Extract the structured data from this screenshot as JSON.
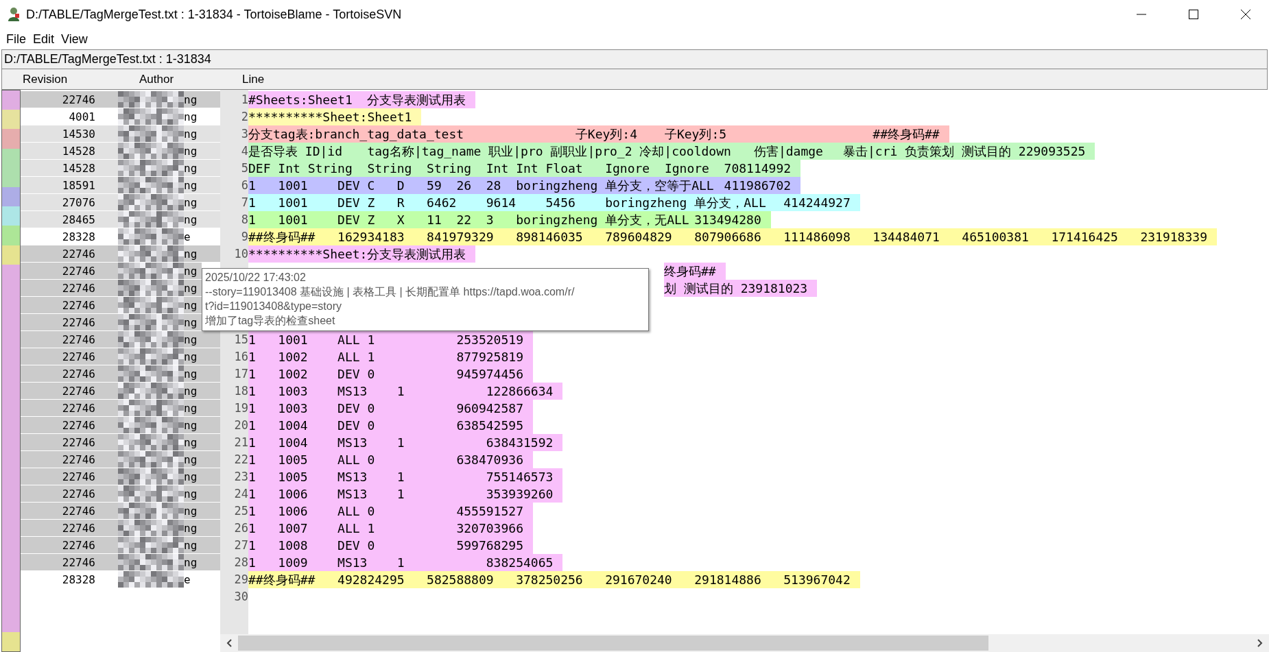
{
  "window": {
    "title": "D:/TABLE/TagMergeTest.txt : 1-31834 - TortoiseBlame - TortoiseSVN"
  },
  "menu": [
    {
      "label": "File"
    },
    {
      "label": "Edit"
    },
    {
      "label": "View"
    }
  ],
  "path_bar": "D:/TABLE/TagMergeTest.txt : 1-31834",
  "columns": [
    {
      "label": "Revision"
    },
    {
      "label": "Author"
    },
    {
      "label": "Line"
    }
  ],
  "lines": [
    {
      "number": "1",
      "revision": "22746",
      "author": "ng",
      "kind": "dark",
      "color": "#f9c0fb",
      "text": "#Sheets:Sheet1\t分支导表测试用表"
    },
    {
      "number": "2",
      "revision": "4001",
      "author": "ng",
      "kind": "none",
      "color": "#fffbb0",
      "text": "**********Sheet:Sheet1"
    },
    {
      "number": "3",
      "revision": "14530",
      "author": "ng",
      "kind": "light",
      "color": "#ffc0c0",
      "text": "分支tag表:branch_tag_data_test\t\t\t\t子Key列:4\t子Key列:5\t\t\t\t\t##终身码##"
    },
    {
      "number": "4",
      "revision": "14528",
      "author": "ng",
      "kind": "light",
      "color": "#c0f8c0",
      "text": "是否导表 ID|id\ttag名称|tag_name 职业|pro 副职业|pro_2 冷却|cooldown\t伤害|damge\t暴击|cri 负责策划 测试目的 229093525"
    },
    {
      "number": "5",
      "revision": "14528",
      "author": "ng",
      "kind": "light",
      "color": "#c0f8c0",
      "text": "DEF\tInt\tString\tString\tString\tInt\tInt\tFloat\tIgnore\tIgnore\t708114992"
    },
    {
      "number": "6",
      "revision": "18591",
      "author": "ng",
      "kind": "light",
      "color": "#c0c0ff",
      "text": "1\t1001\tDEV\tC\tD\t59\t26\t28\tboringzheng\t单分支，空等于ALL\t411986702"
    },
    {
      "number": "7",
      "revision": "27076",
      "author": "ng",
      "kind": "light",
      "color": "#c0ffff",
      "text": "1\t1001\tDEV\tZ\tR\t6462\t9614\t5456\tboringzheng 单分支，ALL\t414244927"
    },
    {
      "number": "8",
      "revision": "28465",
      "author": "ng",
      "kind": "light",
      "color": "#c0ffa8",
      "text": "1\t1001\tDEV\tZ\tX\t11\t22\t3\tboringzheng\t单分支，无ALL\t313494280"
    },
    {
      "number": "9",
      "revision": "28328",
      "author": "e",
      "kind": "none",
      "color": "#fffca0",
      "text": "##终身码##\t162934183\t841979329\t898146035\t789604829\t807906686\t111486098\t134484071\t465100381\t171416425\t231918339"
    },
    {
      "number": "10",
      "revision": "22746",
      "author": "ng",
      "kind": "dark",
      "color": "#f9c0fb",
      "text": "**********Sheet:分支导表测试用表"
    },
    {
      "revision": "22746",
      "author": "ng",
      "kind": "dark",
      "color": "#f9c0fb",
      "covered": true,
      "text": "终身码##"
    },
    {
      "revision": "22746",
      "author": "ng",
      "kind": "dark",
      "color": "#f9c0fb",
      "covered": true,
      "text": "划 测试目的 239181023"
    },
    {
      "revision": "22746",
      "author": "ng",
      "kind": "dark",
      "covered": true
    },
    {
      "revision": "22746",
      "author": "ng",
      "kind": "dark",
      "covered": true
    },
    {
      "number": "15",
      "revision": "22746",
      "author": "ng",
      "kind": "dark",
      "color": "#f9c0fb",
      "text": "1\t1001\tALL\t1\t\t\t253520519"
    },
    {
      "number": "16",
      "revision": "22746",
      "author": "ng",
      "kind": "dark",
      "color": "#f9c0fb",
      "text": "1\t1002\tALL\t1\t\t\t877925819"
    },
    {
      "number": "17",
      "revision": "22746",
      "author": "ng",
      "kind": "dark",
      "color": "#f9c0fb",
      "text": "1\t1002\tDEV\t0\t\t\t945974456"
    },
    {
      "number": "18",
      "revision": "22746",
      "author": "ng",
      "kind": "dark",
      "color": "#f9c0fb",
      "text": "1\t1003\tMS13\t1\t\t\t122866634"
    },
    {
      "number": "19",
      "revision": "22746",
      "author": "ng",
      "kind": "dark",
      "color": "#f9c0fb",
      "text": "1\t1003\tDEV\t0\t\t\t960942587"
    },
    {
      "number": "20",
      "revision": "22746",
      "author": "ng",
      "kind": "dark",
      "color": "#f9c0fb",
      "text": "1\t1004\tDEV\t0\t\t\t638542595"
    },
    {
      "number": "21",
      "revision": "22746",
      "author": "ng",
      "kind": "dark",
      "color": "#f9c0fb",
      "text": "1\t1004\tMS13\t1\t\t\t638431592"
    },
    {
      "number": "22",
      "revision": "22746",
      "author": "ng",
      "kind": "dark",
      "color": "#f9c0fb",
      "text": "1\t1005\tALL\t0\t\t\t638470936"
    },
    {
      "number": "23",
      "revision": "22746",
      "author": "ng",
      "kind": "dark",
      "color": "#f9c0fb",
      "text": "1\t1005\tMS13\t1\t\t\t755146573"
    },
    {
      "number": "24",
      "revision": "22746",
      "author": "ng",
      "kind": "dark",
      "color": "#f9c0fb",
      "text": "1\t1006\tMS13\t1\t\t\t353939260"
    },
    {
      "number": "25",
      "revision": "22746",
      "author": "ng",
      "kind": "dark",
      "color": "#f9c0fb",
      "text": "1\t1006\tALL\t0\t\t\t455591527"
    },
    {
      "number": "26",
      "revision": "22746",
      "author": "ng",
      "kind": "dark",
      "color": "#f9c0fb",
      "text": "1\t1007\tALL\t1\t\t\t320703966"
    },
    {
      "number": "27",
      "revision": "22746",
      "author": "ng",
      "kind": "dark",
      "color": "#f9c0fb",
      "text": "1\t1008\tDEV\t0\t\t\t599768295"
    },
    {
      "number": "28",
      "revision": "22746",
      "author": "ng",
      "kind": "dark",
      "color": "#f9c0fb",
      "text": "1\t1009\tMS13\t1\t\t\t838254065"
    },
    {
      "number": "29",
      "revision": "28328",
      "author": "e",
      "kind": "none",
      "color": "#fffca0",
      "text": "##终身码##\t492824295\t582588809\t378250256\t291670240\t291814886\t513967042"
    },
    {
      "number": "30"
    }
  ],
  "tooltip": {
    "lines": [
      "2025/10/22 17:43:02",
      "--story=119013408 基础设施 | 表格工具 | 长期配置单 https://tapd.woa.com/r/",
      "t?id=119013408&type=story",
      "增加了tag导表的检查sheet"
    ]
  }
}
